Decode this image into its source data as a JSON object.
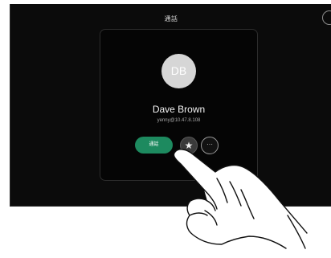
{
  "header": {
    "title": "通話"
  },
  "contact": {
    "initials": "DB",
    "name": "Dave Brown",
    "address": "yenny@10.47.8.108"
  },
  "actions": {
    "call_label": "通話",
    "favorite_icon": "star-icon",
    "more_icon": "more-options-icon",
    "more_glyph": "···",
    "favorite_glyph": "★"
  },
  "colors": {
    "screen_background": "#0b0b0b",
    "call_button": "#1d8a5f",
    "avatar": "#d6d6d6"
  }
}
